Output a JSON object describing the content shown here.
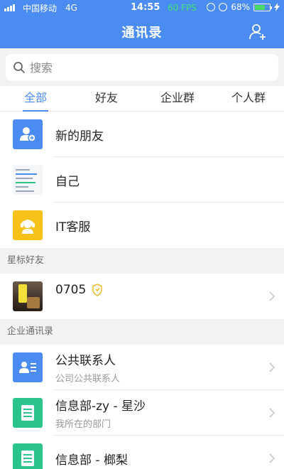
{
  "status_bar": {
    "carrier": "中国移动",
    "network": "4G",
    "time": "14:55",
    "fps": "60 FPS",
    "battery": "68%"
  },
  "header": {
    "title": "通讯录"
  },
  "search": {
    "placeholder": "搜索"
  },
  "tabs": [
    {
      "label": "全部",
      "active": true
    },
    {
      "label": "好友",
      "active": false
    },
    {
      "label": "企业群",
      "active": false
    },
    {
      "label": "个人群",
      "active": false
    }
  ],
  "quick_items": [
    {
      "label": "新的朋友",
      "icon": "add-user-icon",
      "color": "#4a8cf2"
    },
    {
      "label": "自己",
      "icon": "screenshot-thumbnail"
    },
    {
      "label": "IT客服",
      "icon": "customer-service-icon",
      "color": "#f6c219"
    }
  ],
  "starred": {
    "header": "星标好友",
    "items": [
      {
        "name": "0705",
        "icon": "shield-badge-icon"
      }
    ]
  },
  "enterprise": {
    "header": "企业通讯录",
    "items": [
      {
        "title": "公共联系人",
        "subtitle": "公司公共联系人",
        "icon": "contact-card-icon",
        "color": "#4a8cf2"
      },
      {
        "title": "信息部-zy - 星沙",
        "subtitle": "我所在的部门",
        "icon": "department-icon",
        "color": "#2bc48a"
      },
      {
        "title": "信息部 - 榔梨",
        "subtitle": "",
        "icon": "department-icon",
        "color": "#2bc48a"
      }
    ]
  }
}
